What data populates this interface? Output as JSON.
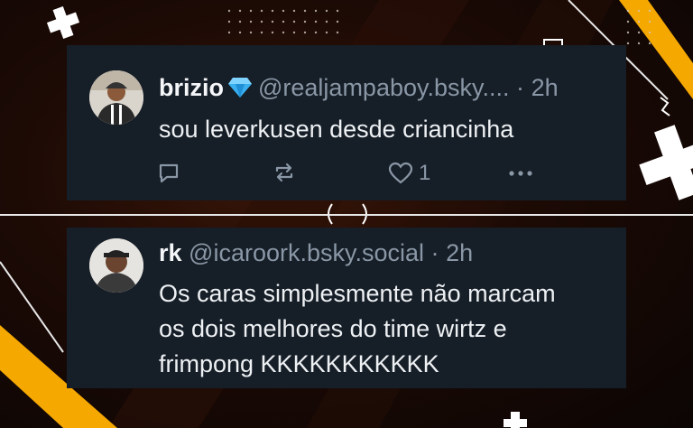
{
  "posts": [
    {
      "name": "brizio",
      "badge_icon": "diamond-emoji",
      "handle": "@realjampaboy.bsky....",
      "separator": "·",
      "time": "2h",
      "text": "sou leverkusen desde criancinha",
      "actions": {
        "reply_icon": "reply-icon",
        "repost_icon": "repost-icon",
        "like_icon": "heart-icon",
        "like_count": "1",
        "more_icon": "more-icon"
      }
    },
    {
      "name": "rk",
      "handle": "@icaroork.bsky.social",
      "separator": "·",
      "time": "2h",
      "text": "Os caras simplesmente não marcam os dois melhores do time wirtz e frimpong KKKKKKKKKKK"
    }
  ],
  "colors": {
    "card_bg": "#161e27",
    "text": "#f1f3f5",
    "muted": "#8a97a6",
    "accent_yellow": "#f5a800"
  }
}
